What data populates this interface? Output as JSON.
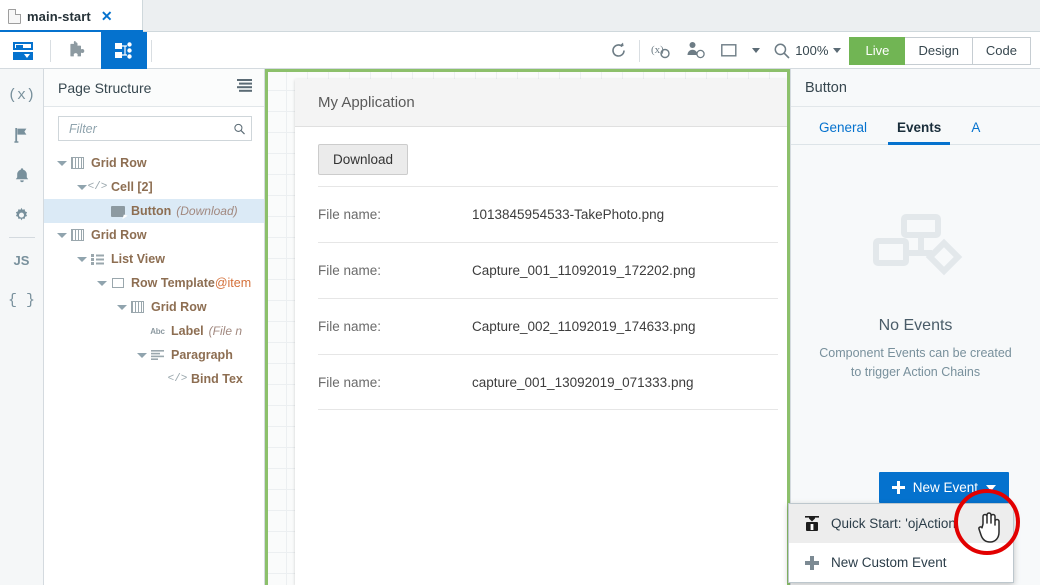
{
  "tab": {
    "title": "main-start",
    "close_label": "✕",
    "file_icon": "file-icon"
  },
  "toolbar": {
    "left_icons": [
      {
        "name": "page-structure-toggle-icon",
        "selected": false
      },
      {
        "name": "extensions-puzzle-icon",
        "selected": false
      },
      {
        "name": "component-structure-icon",
        "selected": true
      }
    ],
    "refresh_icon": "refresh-icon",
    "variables_icon": "variables-icon",
    "user-context_icon": "user-context-icon",
    "screen_size_label": "",
    "zoom_level": "100%",
    "views": [
      {
        "label": "Live",
        "active": true
      },
      {
        "label": "Design",
        "active": false
      },
      {
        "label": "Code",
        "active": false
      }
    ]
  },
  "rail": {
    "items": [
      {
        "name": "variables-icon",
        "glyph": "(x)"
      },
      {
        "name": "flags-icon",
        "glyph": "flag"
      },
      {
        "name": "notifications-icon",
        "glyph": "bell"
      },
      {
        "name": "settings-gear-icon",
        "glyph": "gear"
      },
      {
        "name": "javascript-icon",
        "glyph": "JS"
      },
      {
        "name": "json-icon",
        "glyph": "{ }"
      }
    ]
  },
  "page_structure": {
    "title": "Page Structure",
    "menu_icon": "hamburger-menu-icon",
    "filter_placeholder": "Filter",
    "filter_value": "",
    "search_icon": "search-icon",
    "tree": [
      {
        "indent": 0,
        "twisty": true,
        "icon": "grid-icon",
        "label": "Grid Row",
        "sub": "",
        "selected": false,
        "orange": ""
      },
      {
        "indent": 1,
        "twisty": true,
        "icon": "code-icon",
        "label": "Cell [2]",
        "sub": "",
        "selected": false,
        "orange": ""
      },
      {
        "indent": 2,
        "twisty": false,
        "icon": "button-icon",
        "label": "Button",
        "sub": "(Download)",
        "selected": true,
        "orange": ""
      },
      {
        "indent": 0,
        "twisty": true,
        "icon": "grid-icon",
        "label": "Grid Row",
        "sub": "",
        "selected": false,
        "orange": ""
      },
      {
        "indent": 1,
        "twisty": true,
        "icon": "list-icon",
        "label": "List View",
        "sub": "",
        "selected": false,
        "orange": ""
      },
      {
        "indent": 2,
        "twisty": true,
        "icon": "row-template-icon",
        "label": "Row Template",
        "sub": "",
        "selected": false,
        "orange": "@item"
      },
      {
        "indent": 3,
        "twisty": true,
        "icon": "grid-icon",
        "label": "Grid Row",
        "sub": "",
        "selected": false,
        "orange": ""
      },
      {
        "indent": 4,
        "twisty": false,
        "icon": "abc-icon",
        "label": "Label",
        "sub": "(File n",
        "selected": false,
        "orange": ""
      },
      {
        "indent": 4,
        "twisty": true,
        "icon": "paragraph-icon",
        "label": "Paragraph",
        "sub": "",
        "selected": false,
        "orange": ""
      },
      {
        "indent": 5,
        "twisty": false,
        "icon": "code-icon",
        "label": "Bind Tex",
        "sub": "",
        "selected": false,
        "orange": ""
      }
    ]
  },
  "canvas": {
    "app_title": "My Application",
    "download_button": "Download",
    "rows": [
      {
        "key": "File name:",
        "value": "1013845954533-TakePhoto.png"
      },
      {
        "key": "File name:",
        "value": "Capture_001_11092019_172202.png"
      },
      {
        "key": "File name:",
        "value": "Capture_002_11092019_174633.png"
      },
      {
        "key": "File name:",
        "value": "capture_001_13092019_071333.png"
      }
    ]
  },
  "properties": {
    "title": "Button",
    "tabs": [
      {
        "label": "General",
        "active": false
      },
      {
        "label": "Events",
        "active": true
      },
      {
        "label": "A",
        "active": false
      }
    ],
    "empty_icon": "action-chain-icon",
    "empty_title": "No Events",
    "empty_desc": "Component Events can be created\nto trigger Action Chains",
    "new_event_button": "New Event",
    "plus_icon": "plus-icon",
    "dropdown_caret_icon": "chevron-down-icon"
  },
  "menu": {
    "items": [
      {
        "label": "Quick Start: 'ojAction'",
        "icon": "quick-start-icon",
        "hover": true
      },
      {
        "label": "New Custom Event",
        "icon": "plus-icon",
        "hover": false
      }
    ]
  },
  "annotation": {
    "circle": "red-highlight-circle",
    "cursor": "hand-cursor"
  },
  "colors": {
    "accent_blue": "#0572ce",
    "live_green": "#71b554",
    "canvas_highlight": "#8cc06b",
    "annotation_red": "#e20000",
    "tree_text": "#8d6e52",
    "tree_orange": "#d4703a"
  }
}
